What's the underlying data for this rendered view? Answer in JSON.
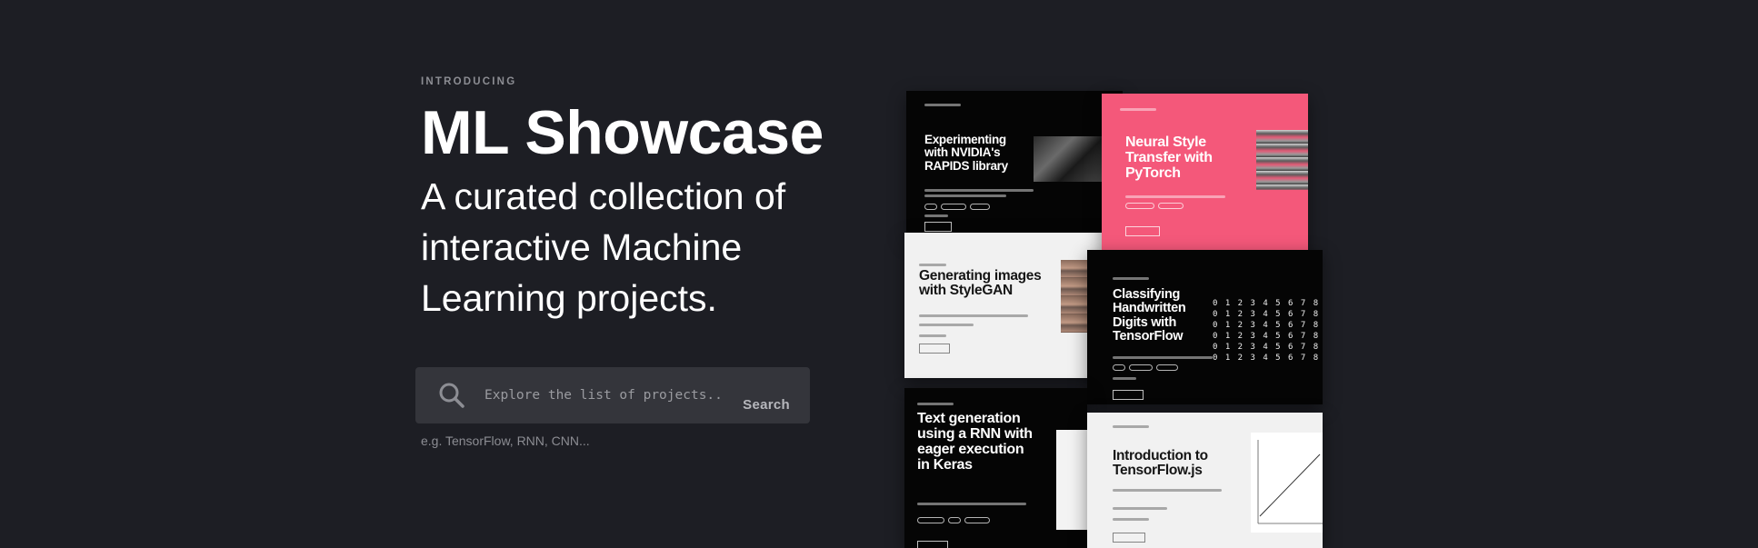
{
  "hero": {
    "eyebrow": "INTRODUCING",
    "title": "ML Showcase",
    "subtitle": "A curated collection of interactive Machine Learning projects."
  },
  "search": {
    "icon": "search-icon",
    "placeholder": "Explore the list of projects...",
    "button_label": "Search",
    "example": "e.g. TensorFlow, RNN, CNN..."
  },
  "cards": {
    "rapids": {
      "title": "Experimenting with NVIDIA's RAPIDS library"
    },
    "style_transfer": {
      "title": "Neural Style Transfer with PyTorch"
    },
    "stylegan": {
      "title": "Generating images with StyleGAN"
    },
    "digits": {
      "title": "Classifying Handwritten Digits with TensorFlow",
      "digits_grid": "0 1 2 3 4 5 6 7 8\n0 1 2 3 4 5 6 7 8\n0 1 2 3 4 5 6 7 8\n0 1 2 3 4 5 6 7 8\n0 1 2 3 4 5 6 7 8\n0 1 2 3 4 5 6 7 8"
    },
    "text_gen": {
      "title": "Text generation using a RNN with eager execution in Keras"
    },
    "tfjs": {
      "title": "Introduction to TensorFlow.js"
    }
  },
  "colors": {
    "background": "#1d1e24",
    "search_bg": "#34353b",
    "accent_pink": "#f4587a"
  }
}
